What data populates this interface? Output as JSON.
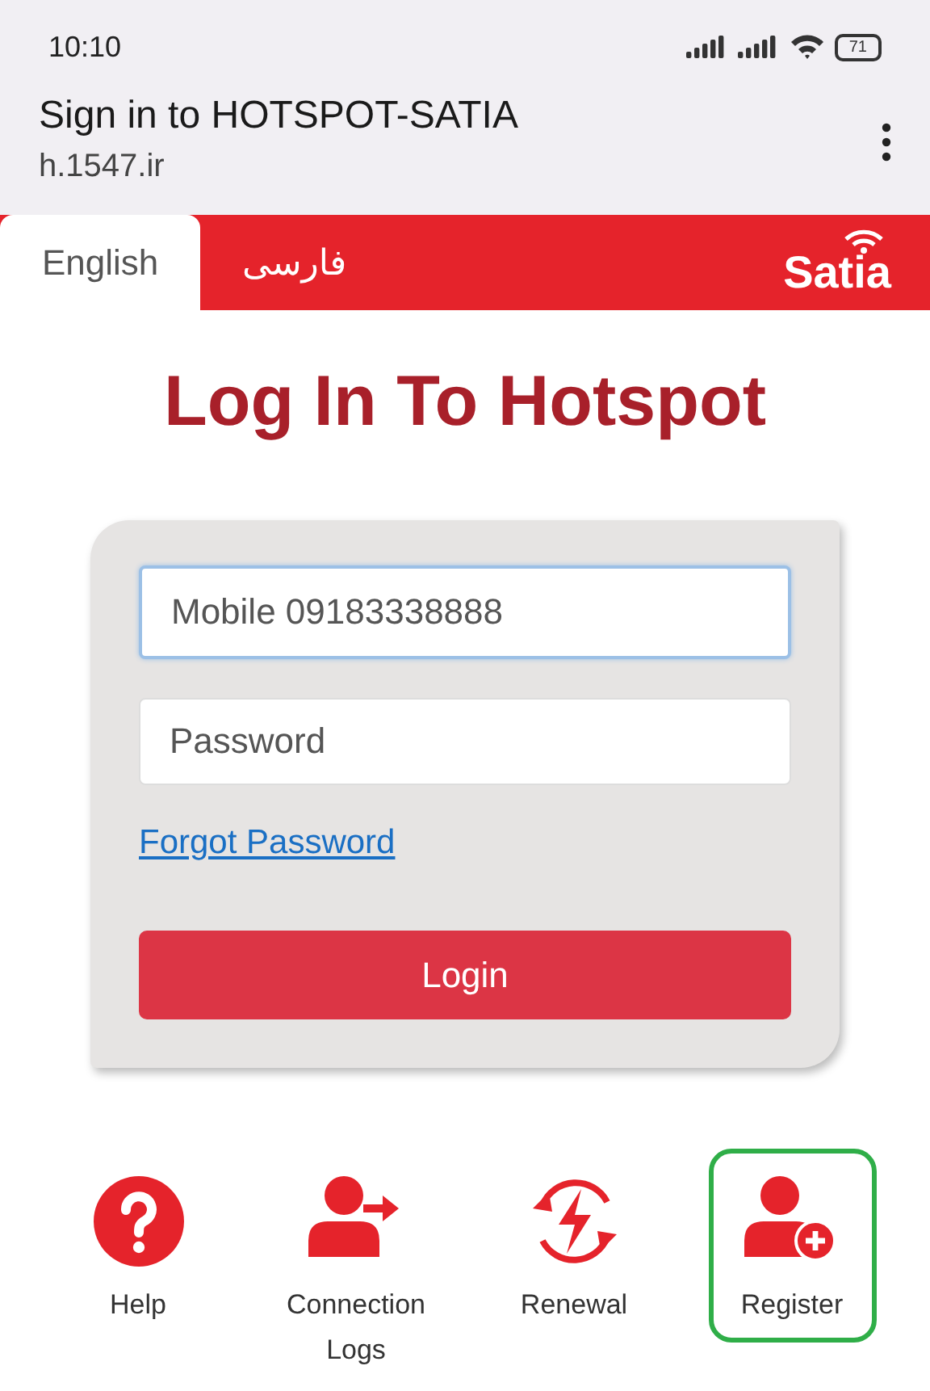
{
  "status_bar": {
    "time": "10:10",
    "battery": "71"
  },
  "browser": {
    "title": "Sign in to HOTSPOT-SATIA",
    "url": "h.1547.ir"
  },
  "tabs": [
    {
      "label": "English",
      "selected": true
    },
    {
      "label": "فارسی",
      "selected": false
    }
  ],
  "logo": "Satia",
  "heading": "Log In To Hotspot",
  "form": {
    "mobile": {
      "placeholder": "Mobile 09183338888",
      "focused": true
    },
    "password": {
      "placeholder": "Password"
    },
    "forgot_link": "Forgot Password",
    "login_button": "Login"
  },
  "actions": [
    {
      "kind": "help",
      "label": "Help",
      "selected": false
    },
    {
      "kind": "logs",
      "label": "Connection Logs",
      "selected": false
    },
    {
      "kind": "renewal",
      "label": "Renewal",
      "selected": false
    },
    {
      "kind": "register",
      "label": "Register",
      "selected": true
    }
  ]
}
